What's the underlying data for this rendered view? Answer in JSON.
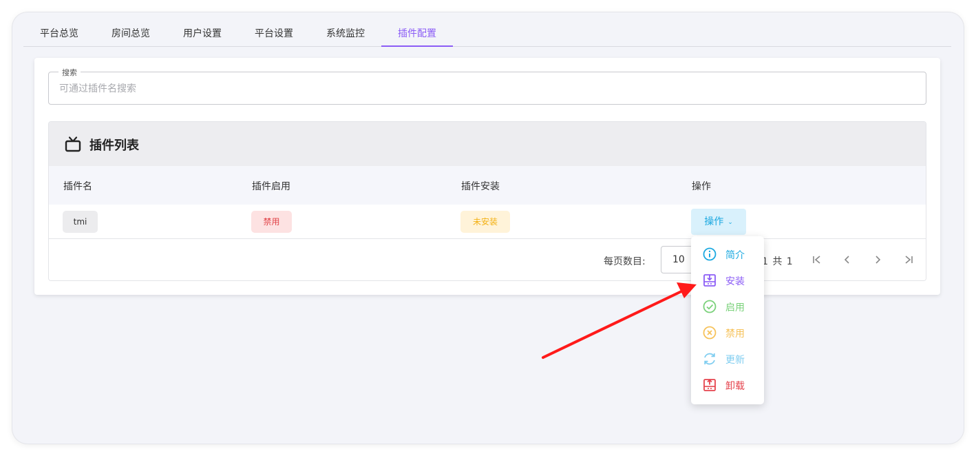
{
  "tabs": [
    {
      "label": "平台总览"
    },
    {
      "label": "房间总览"
    },
    {
      "label": "用户设置"
    },
    {
      "label": "平台设置"
    },
    {
      "label": "系统监控"
    },
    {
      "label": "插件配置"
    }
  ],
  "active_tab": "插件配置",
  "search": {
    "legend": "搜索",
    "placeholder": "可通过插件名搜索",
    "value": ""
  },
  "panel": {
    "icon": "tv-icon",
    "title": "插件列表"
  },
  "table": {
    "headers": [
      "插件名",
      "插件启用",
      "插件安装",
      "操作"
    ],
    "rows": [
      {
        "name": "tmi",
        "enabled": "禁用",
        "installed": "未安装",
        "action": "操作"
      }
    ]
  },
  "pagination": {
    "rows_per_page_label": "每页数目:",
    "rows_per_page": "10",
    "page_info": "1 共 1",
    "buttons": [
      "first-page-icon",
      "prev-page-icon",
      "next-page-icon",
      "last-page-icon"
    ]
  },
  "dropdown": {
    "items": [
      {
        "label": "简介",
        "icon": "info-icon",
        "color": "#1aa8e0"
      },
      {
        "label": "安装",
        "icon": "install-icon",
        "color": "#8b5cf6"
      },
      {
        "label": "启用",
        "icon": "check-circle-icon",
        "color": "#7ad17a"
      },
      {
        "label": "禁用",
        "icon": "x-circle-icon",
        "color": "#f6c25a"
      },
      {
        "label": "更新",
        "icon": "refresh-icon",
        "color": "#7fcdf0"
      },
      {
        "label": "卸载",
        "icon": "uninstall-icon",
        "color": "#e5434d"
      }
    ]
  },
  "annotation": {
    "color": "#ff1a1a"
  }
}
